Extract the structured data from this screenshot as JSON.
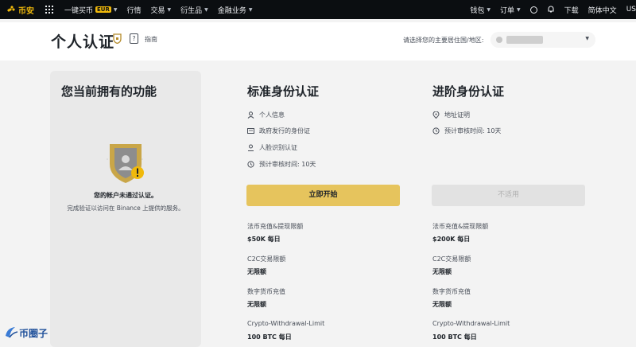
{
  "topbar": {
    "logo_text": "币安",
    "nav": [
      {
        "label": "一键买币",
        "badge": "EUR",
        "has_caret": true
      },
      {
        "label": "行情",
        "badge": "",
        "has_caret": false
      },
      {
        "label": "交易",
        "badge": "",
        "has_caret": true
      },
      {
        "label": "衍生品",
        "badge": "",
        "has_caret": true
      },
      {
        "label": "金融业务",
        "badge": "",
        "has_caret": true
      }
    ],
    "right": {
      "wallet": "钱包",
      "orders": "订单",
      "download": "下载",
      "language": "简体中文",
      "currency": "US"
    }
  },
  "header": {
    "title": "个人认证",
    "guide": "指南",
    "country_label": "请选择您的主要居住国/地区:"
  },
  "current": {
    "title": "您当前拥有的功能",
    "status_main": "您的帐户未通过认证。",
    "status_sub": "完成验证以访问在 Binance 上提供的服务。"
  },
  "standard": {
    "title": "标准身份认证",
    "features": [
      {
        "icon": "person-icon",
        "label": "个人信息"
      },
      {
        "icon": "id-card-icon",
        "label": "政府发行的身份证"
      },
      {
        "icon": "face-icon",
        "label": "人脸识别认证"
      },
      {
        "icon": "clock-icon",
        "label": "预计审核时间: 10天"
      }
    ],
    "button": "立即开始",
    "limits": [
      {
        "label": "法币充值&提现限额",
        "value": "$50K 每日"
      },
      {
        "label": "C2C交易限额",
        "value": "无限额"
      },
      {
        "label": "数字货币充值",
        "value": "无限额"
      },
      {
        "label": "Crypto-Withdrawal-Limit",
        "value": "100 BTC 每日"
      }
    ]
  },
  "advanced": {
    "title": "进阶身份认证",
    "features": [
      {
        "icon": "location-icon",
        "label": "地址证明"
      },
      {
        "icon": "clock-icon",
        "label": "预计审核时间: 10天"
      }
    ],
    "button": "不适用",
    "limits": [
      {
        "label": "法币充值&提现限额",
        "value": "$200K 每日"
      },
      {
        "label": "C2C交易限额",
        "value": "无限额"
      },
      {
        "label": "数字货币充值",
        "value": "无限额"
      },
      {
        "label": "Crypto-Withdrawal-Limit",
        "value": "100 BTC 每日"
      }
    ]
  },
  "watermark": "币圈子",
  "colors": {
    "brand": "#f0b90b",
    "primary_button": "#e6c45d",
    "topbar": "#0b0e11"
  }
}
